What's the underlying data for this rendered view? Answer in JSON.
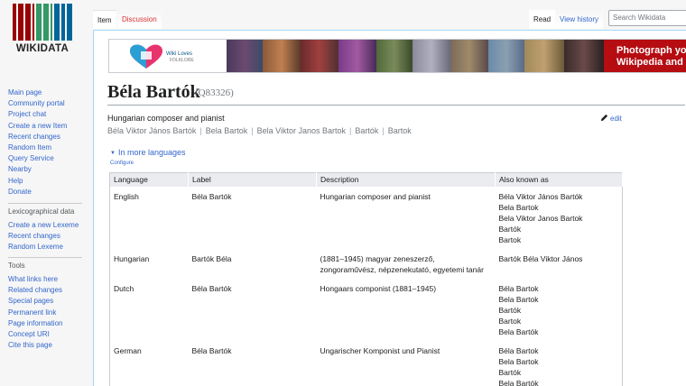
{
  "logo": {
    "wordmark": "WIKIDATA"
  },
  "sidebar": {
    "main": [
      "Main page",
      "Community portal",
      "Project chat",
      "Create a new Item",
      "Recent changes",
      "Random Item",
      "Query Service",
      "Nearby",
      "Help",
      "Donate"
    ],
    "lexicographical": {
      "heading": "Lexicographical data",
      "items": [
        "Create a new Lexeme",
        "Recent changes",
        "Random Lexeme"
      ]
    },
    "tools": {
      "heading": "Tools",
      "items": [
        "What links here",
        "Related changes",
        "Special pages",
        "Permanent link",
        "Page information",
        "Concept URI",
        "Cite this page"
      ]
    }
  },
  "tabs": {
    "item": "Item",
    "discussion": "Discussion",
    "read": "Read",
    "history": "View history"
  },
  "search": {
    "placeholder": "Search Wikidata"
  },
  "banner": {
    "logo_line1": "Wiki Loves",
    "logo_line2": "FOLKLORE",
    "cta_line1": "Photograph your",
    "cta_line2": "Wikipedia and w"
  },
  "item": {
    "title": "Béla Bartók",
    "qid": "(Q83326)",
    "description": "Hungarian composer and pianist",
    "aliases": [
      "Béla Viktor János Bartók",
      "Bela Bartok",
      "Bela Viktor Janos Bartok",
      "Bartók",
      "Bartok"
    ],
    "edit_label": "edit"
  },
  "languages": {
    "toggle": "In more languages",
    "configure": "Configure",
    "headers": [
      "Language",
      "Label",
      "Description",
      "Also known as"
    ],
    "rows": [
      {
        "language": "English",
        "label": "Béla Bartók",
        "description": [
          "Hungarian composer and pianist"
        ],
        "also": [
          "Béla Viktor János Bartók",
          "Bela Bartok",
          "Bela Viktor Janos Bartok",
          "Bartók",
          "Bartok"
        ]
      },
      {
        "language": "Hungarian",
        "label": "Bartók Béla",
        "description": [
          "(1881–1945) magyar zeneszerző,",
          "zongoraművész, népzenekutató, egyetemi tanár"
        ],
        "also": [
          "Bartók Béla Viktor János"
        ]
      },
      {
        "language": "Dutch",
        "label": "Béla Bartók",
        "description": [
          "Hongaars componist (1881–1945)"
        ],
        "also": [
          "Béla Bartok",
          "Bela Bartok",
          "Bartók",
          "Bartok",
          "Bela Bartók"
        ]
      },
      {
        "language": "German",
        "label": "Béla Bartók",
        "description": [
          "Ungarischer Komponist und Pianist"
        ],
        "also": [
          "Béla Bartok",
          "Bela Bartok",
          "Bartók",
          "Bela Bartók"
        ]
      }
    ]
  },
  "colors": {
    "link": "#3366cc",
    "discussion": "#dd3333",
    "banner_cta": "#b50d12"
  }
}
